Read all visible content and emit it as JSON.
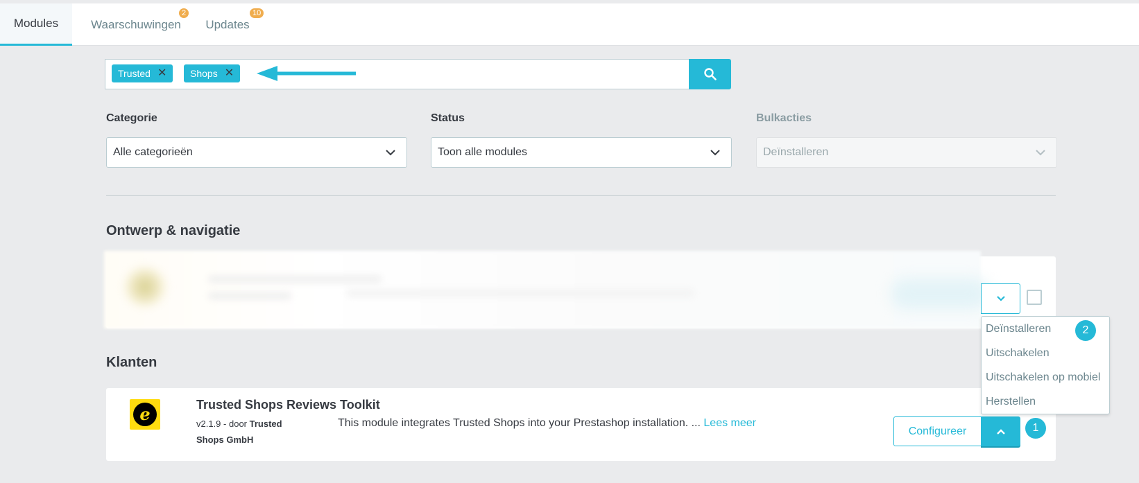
{
  "tabs": [
    {
      "label": "Modules",
      "badge": null,
      "active": true
    },
    {
      "label": "Waarschuwingen",
      "badge": "2",
      "active": false
    },
    {
      "label": "Updates",
      "badge": "10",
      "active": false
    }
  ],
  "search": {
    "tags": [
      "Trusted",
      "Shops"
    ],
    "icon": "search-icon"
  },
  "filters": {
    "category": {
      "label": "Categorie",
      "value": "Alle categorieën"
    },
    "status": {
      "label": "Status",
      "value": "Toon alle modules"
    },
    "bulk": {
      "label": "Bulkacties",
      "value": "Deïnstalleren",
      "disabled": true
    }
  },
  "sections": {
    "design_title": "Ontwerp & navigatie",
    "customers_title": "Klanten"
  },
  "dropdown_menu": {
    "items": [
      "Deïnstalleren",
      "Uitschakelen",
      "Uitschakelen op mobiel",
      "Herstellen"
    ]
  },
  "annotations": {
    "badge_1": "1",
    "badge_2": "2"
  },
  "module": {
    "name": "Trusted Shops Reviews Toolkit",
    "version": "v2.1.9",
    "by": "- door",
    "author": "Trusted Shops GmbH",
    "description": "This module integrates Trusted Shops into your Prestashop installation. ...",
    "read_more": "Lees meer",
    "configure_label": "Configureer"
  },
  "colors": {
    "accent": "#25b9d7",
    "badge": "#f0ad4e",
    "background": "#eaebed"
  }
}
